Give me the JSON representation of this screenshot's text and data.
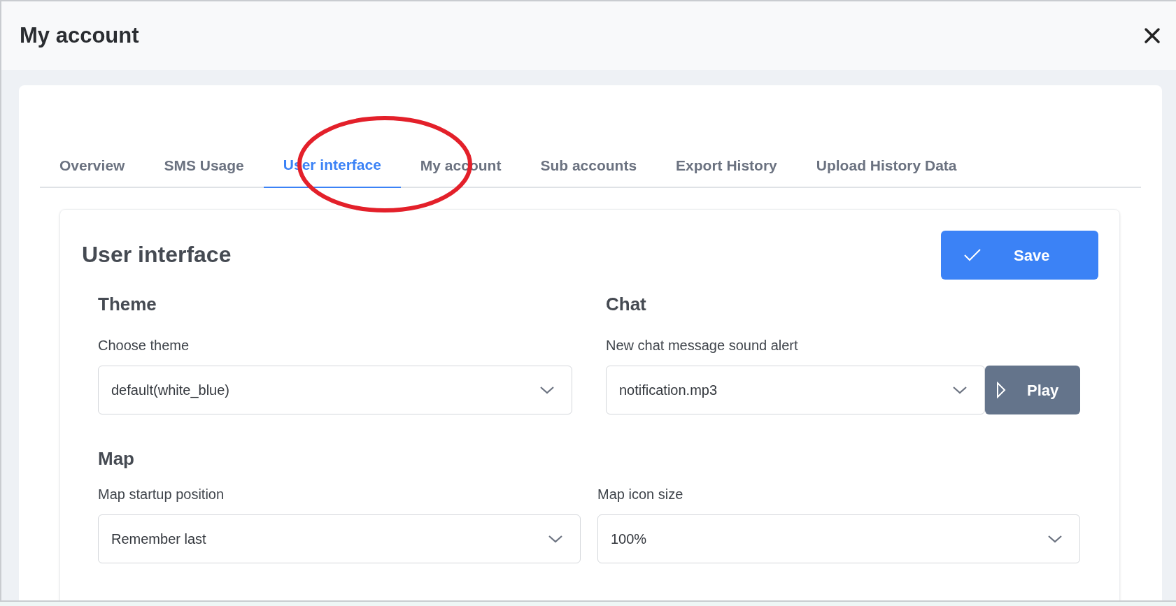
{
  "window": {
    "title": "My account"
  },
  "tabs": [
    {
      "label": "Overview",
      "selected": false
    },
    {
      "label": "SMS Usage",
      "selected": false
    },
    {
      "label": "User interface",
      "selected": true
    },
    {
      "label": "My account",
      "selected": false
    },
    {
      "label": "Sub accounts",
      "selected": false
    },
    {
      "label": "Export History",
      "selected": false
    },
    {
      "label": "Upload History Data",
      "selected": false
    }
  ],
  "panel": {
    "title": "User interface",
    "save_button": "Save"
  },
  "sections": [
    {
      "title": "Theme",
      "fields": [
        {
          "label": "Choose theme",
          "value": "default(white_blue)"
        }
      ]
    },
    {
      "title": "Chat",
      "fields": [
        {
          "label": "New chat message sound alert",
          "value": "notification.mp3",
          "button": "Play"
        }
      ]
    }
  ],
  "map": {
    "title": "Map",
    "fields": [
      {
        "label": "Map startup position",
        "value": "Remember last"
      },
      {
        "label": "Map icon size",
        "value": "100%"
      }
    ]
  }
}
